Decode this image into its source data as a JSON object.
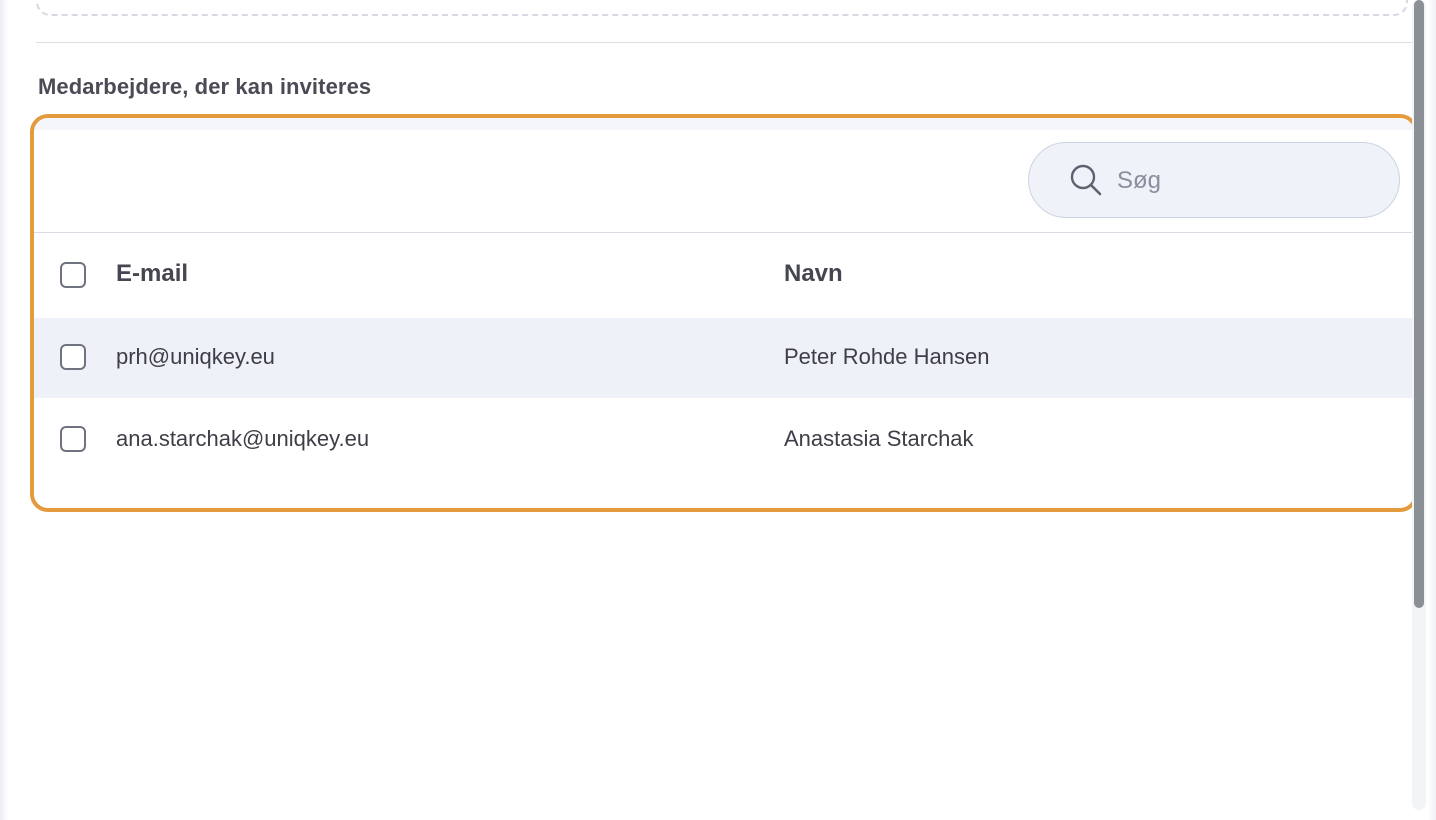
{
  "section": {
    "title": "Medarbejdere, der kan inviteres"
  },
  "search": {
    "placeholder": "Søg",
    "value": ""
  },
  "table": {
    "columns": {
      "email": "E-mail",
      "name": "Navn"
    },
    "rows": [
      {
        "email": "prh@uniqkey.eu",
        "name": "Peter Rohde Hansen"
      },
      {
        "email": "ana.starchak@uniqkey.eu",
        "name": "Anastasia Starchak"
      }
    ]
  },
  "colors": {
    "highlight_border": "#e39b3d",
    "row_hover": "#eef1f8",
    "search_bg": "#f0f2f9"
  },
  "icons": {
    "search": "search-icon"
  }
}
